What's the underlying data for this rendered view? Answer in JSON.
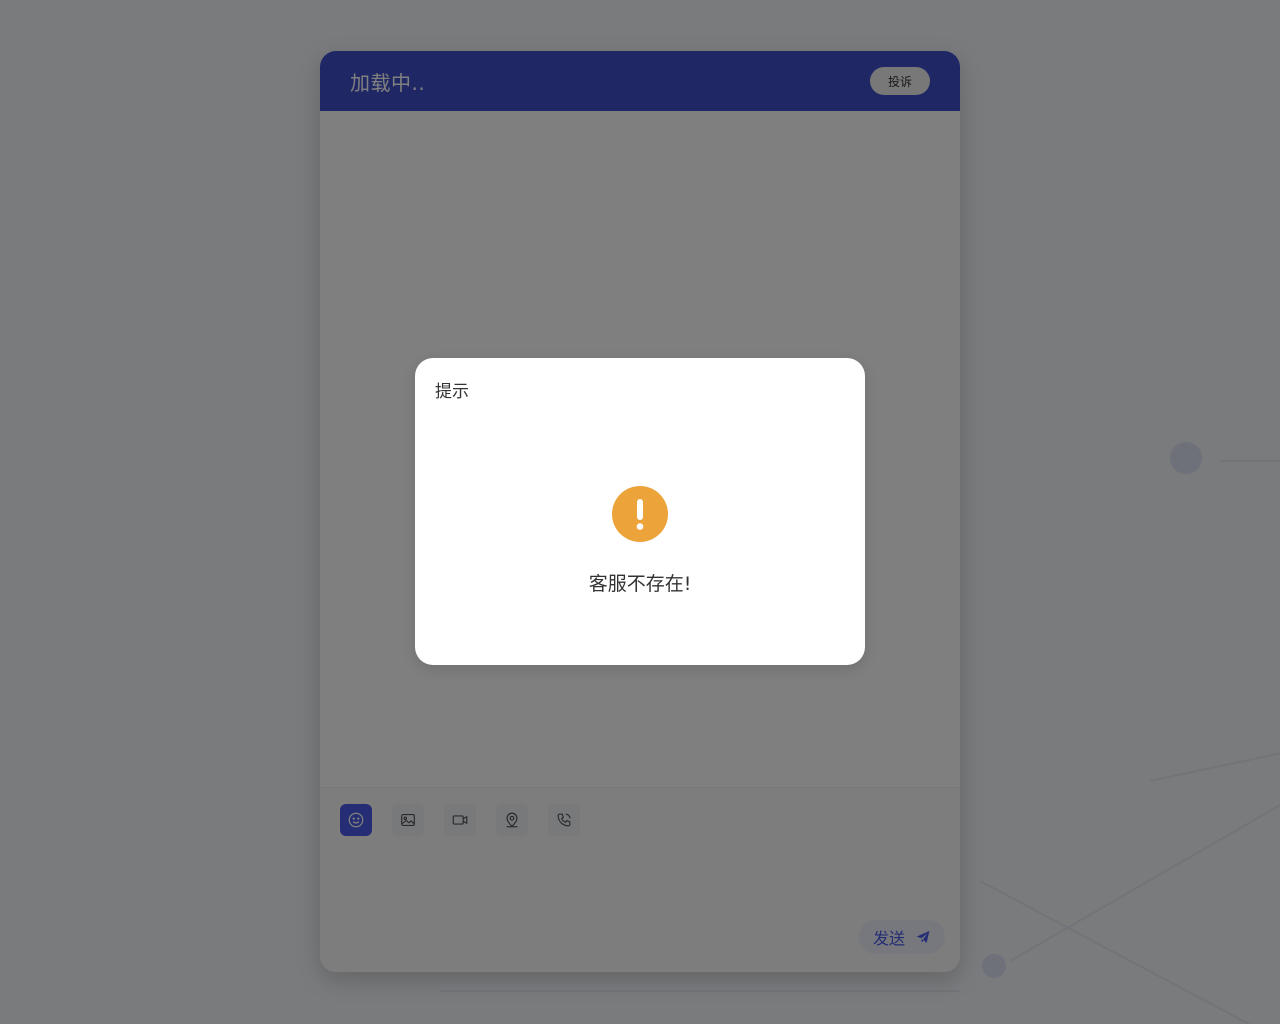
{
  "chat": {
    "title": "加载中..",
    "complain_label": "投诉",
    "send_label": "发送",
    "toolbar": [
      {
        "icon": "emoji-icon",
        "active": true
      },
      {
        "icon": "image-icon",
        "active": false
      },
      {
        "icon": "video-icon",
        "active": false
      },
      {
        "icon": "location-icon",
        "active": false
      },
      {
        "icon": "phone-icon",
        "active": false
      }
    ],
    "input_value": ""
  },
  "dialog": {
    "title": "提示",
    "icon": "warning-icon",
    "message": "客服不存在!"
  },
  "colors": {
    "accent": "#3e51c8",
    "warning": "#eba33a"
  }
}
